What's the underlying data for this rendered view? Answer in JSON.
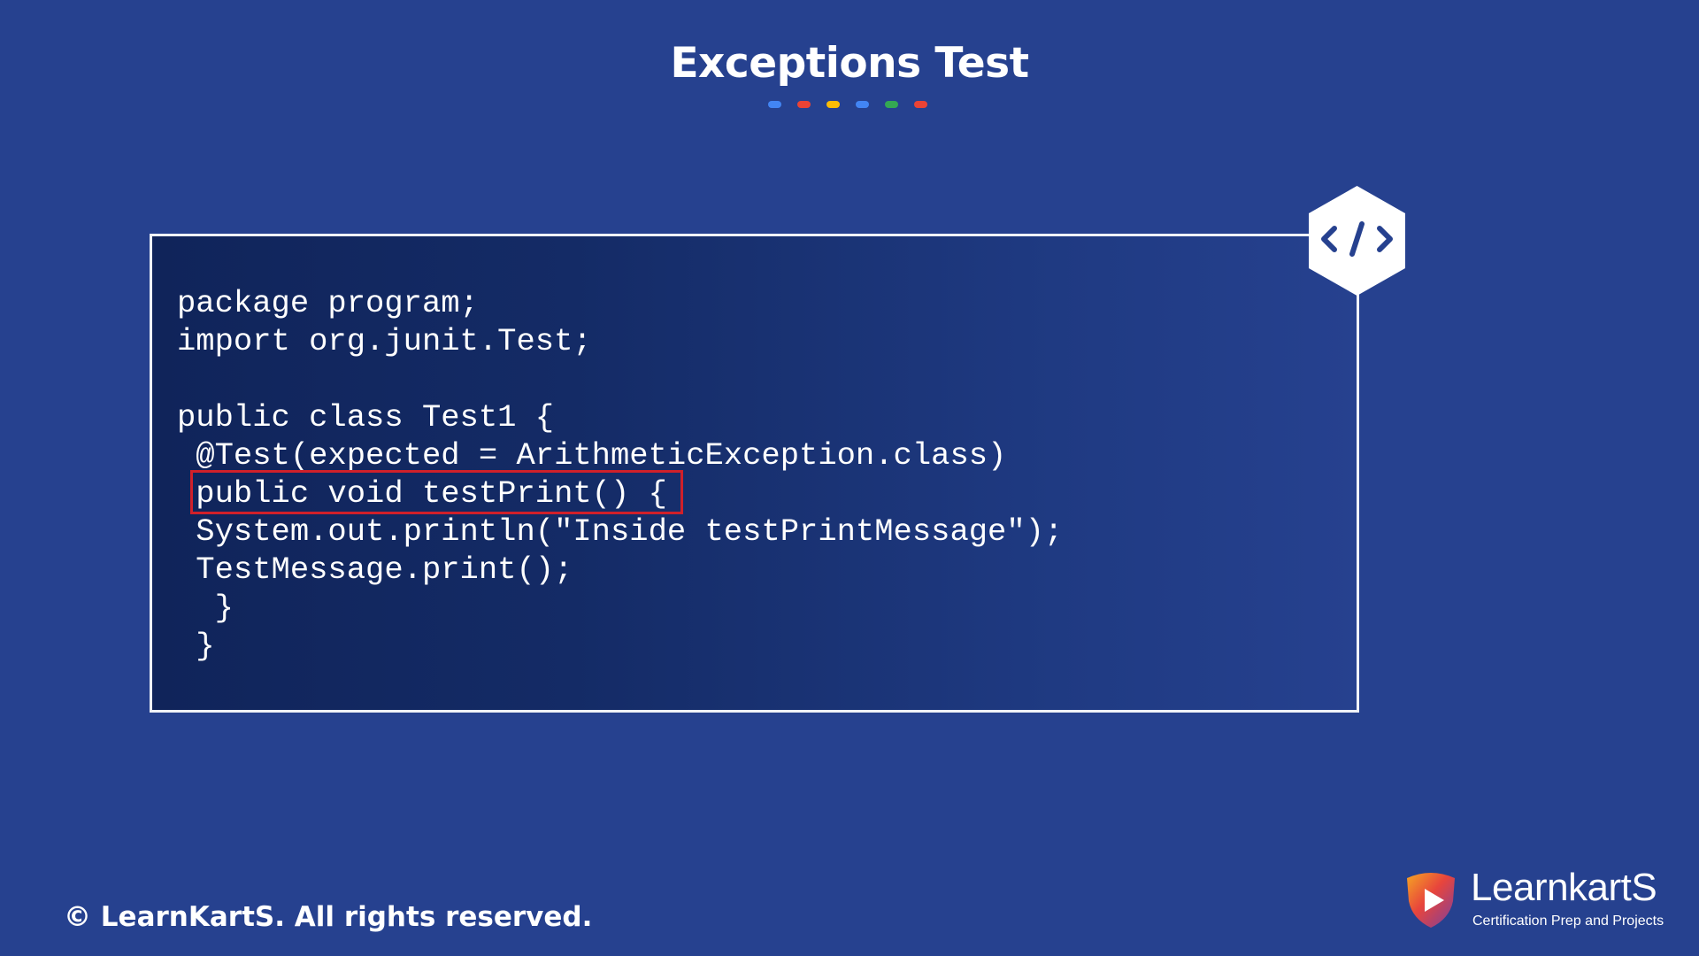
{
  "slide": {
    "title": "Exceptions Test",
    "dots": [
      "#4285f4",
      "#ea4335",
      "#fbbc05",
      "#4285f4",
      "#34a853",
      "#ea4335"
    ]
  },
  "code_panel": {
    "icon": "code-icon",
    "lines": [
      "package program;",
      "import org.junit.Test;",
      "",
      "public class Test1 {",
      " @Test(expected = ArithmeticException.class)",
      " public void testPrint() {",
      " System.out.println(\"Inside testPrintMessage\");",
      " TestMessage.print();",
      "  }",
      " }"
    ],
    "highlight_color": "#d0202a"
  },
  "footer": {
    "copyright": "© LearnKartS. All rights reserved.",
    "brand_name": "LearnkartS",
    "brand_tagline": "Certification Prep and Projects"
  }
}
